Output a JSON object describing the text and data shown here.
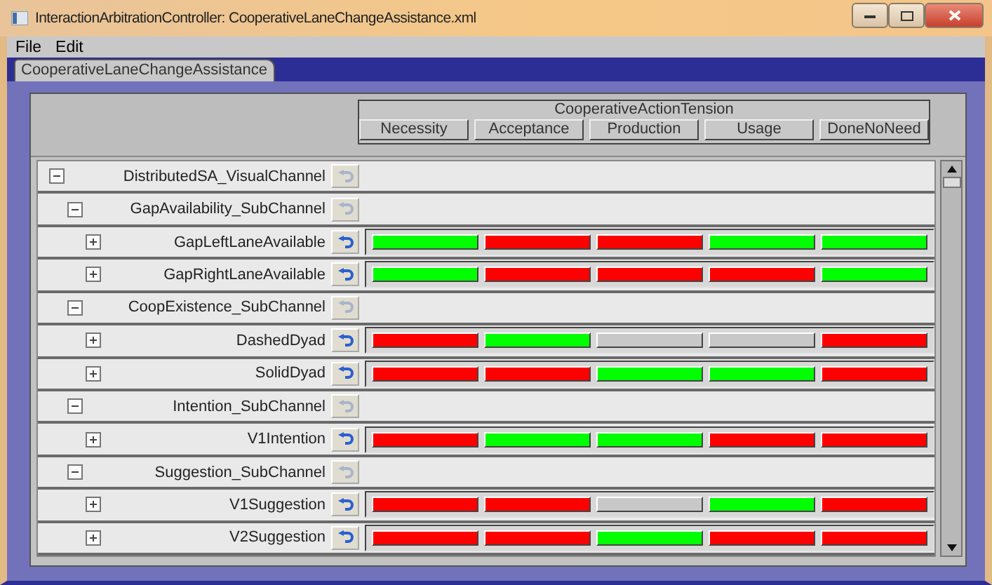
{
  "window": {
    "title": "InteractionArbitrationController: CooperativeLaneChangeAssistance.xml"
  },
  "menu": [
    "File",
    "Edit"
  ],
  "tabs": [
    {
      "label": "CooperativeLaneChangeAssistance",
      "selected": true
    }
  ],
  "header": {
    "group": "CooperativeActionTension",
    "columns": [
      "Necessity",
      "Acceptance",
      "Production",
      "Usage",
      "DoneNoNeed"
    ]
  },
  "tree": [
    {
      "label": "DistributedSA_VisualChannel",
      "expanded": true,
      "children": [
        {
          "label": "GapAvailability_SubChannel",
          "expanded": true,
          "children": [
            {
              "label": "GapLeftLaneAvailable",
              "expanded": false,
              "cells": [
                {
                  "color": "#00ff00"
                },
                {
                  "color": "#ff0000"
                },
                {
                  "color": "#ff0000"
                },
                {
                  "color": "#00ff00"
                },
                {
                  "color": "#00ff00"
                }
              ]
            },
            {
              "label": "GapRightLaneAvailable",
              "expanded": false,
              "cells": [
                {
                  "color": "#00ff00"
                },
                {
                  "color": "#ff0000"
                },
                {
                  "color": "#ff0000"
                },
                {
                  "color": "#ff0000"
                },
                {
                  "color": "#00ff00"
                }
              ]
            }
          ]
        },
        {
          "label": "CoopExistence_SubChannel",
          "expanded": true,
          "children": [
            {
              "label": "DashedDyad",
              "expanded": false,
              "cells": [
                {
                  "color": "#ff0000"
                },
                {
                  "color": "#00ff00"
                },
                {
                  "color": "#c8c8c8"
                },
                {
                  "color": "#c8c8c8"
                },
                {
                  "color": "#ff0000"
                }
              ]
            },
            {
              "label": "SolidDyad",
              "expanded": false,
              "cells": [
                {
                  "color": "#ff0000"
                },
                {
                  "color": "#ff0000"
                },
                {
                  "color": "#00ff00"
                },
                {
                  "color": "#00ff00"
                },
                {
                  "color": "#ff0000"
                }
              ]
            }
          ]
        },
        {
          "label": "Intention_SubChannel",
          "expanded": true,
          "children": [
            {
              "label": "V1Intention",
              "expanded": false,
              "cells": [
                {
                  "color": "#ff0000"
                },
                {
                  "color": "#00ff00"
                },
                {
                  "color": "#00ff00"
                },
                {
                  "color": "#ff0000"
                },
                {
                  "color": "#ff0000"
                }
              ]
            }
          ]
        },
        {
          "label": "Suggestion_SubChannel",
          "expanded": true,
          "children": [
            {
              "label": "V1Suggestion",
              "expanded": false,
              "cells": [
                {
                  "color": "#ff0000"
                },
                {
                  "color": "#ff0000"
                },
                {
                  "color": "#c8c8c8"
                },
                {
                  "color": "#00ff00"
                },
                {
                  "color": "#ff0000"
                }
              ]
            },
            {
              "label": "V2Suggestion",
              "expanded": false,
              "cells": [
                {
                  "color": "#ff0000"
                },
                {
                  "color": "#ff0000"
                },
                {
                  "color": "#00ff00"
                },
                {
                  "color": "#ff0000"
                },
                {
                  "color": "#ff0000"
                }
              ]
            }
          ]
        }
      ]
    }
  ]
}
